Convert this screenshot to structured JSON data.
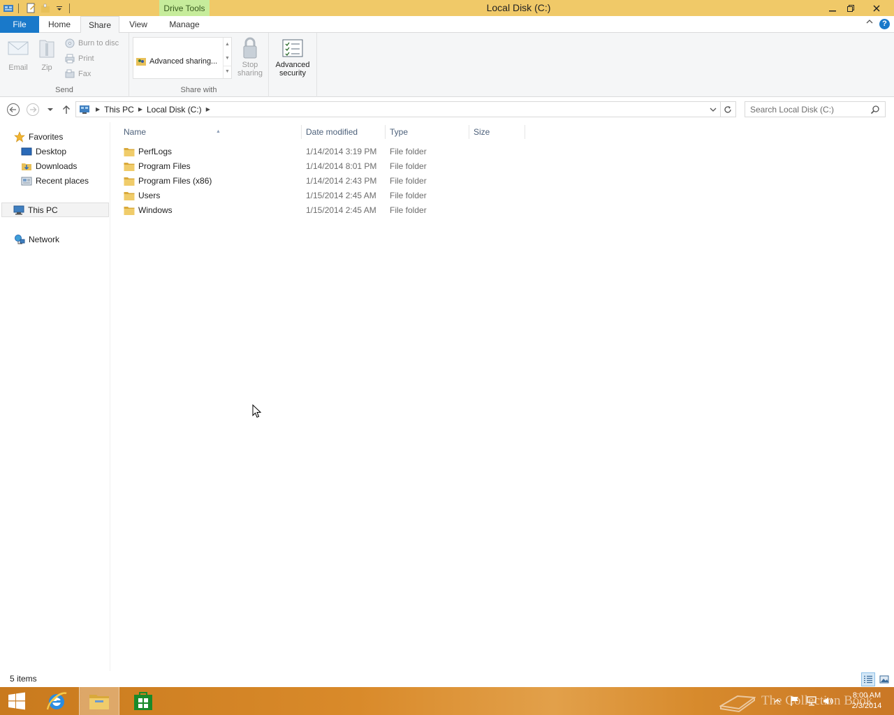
{
  "window": {
    "title": "Local Disk (C:)",
    "context_tab": "Drive Tools"
  },
  "ribbon": {
    "tabs": [
      {
        "label": "File"
      },
      {
        "label": "Home"
      },
      {
        "label": "Share"
      },
      {
        "label": "View"
      },
      {
        "label": "Manage"
      }
    ],
    "send": {
      "group_label": "Send",
      "email": "Email",
      "zip": "Zip",
      "burn": "Burn to disc",
      "print": "Print",
      "fax": "Fax"
    },
    "share_with": {
      "group_label": "Share with",
      "advanced_sharing": "Advanced sharing...",
      "stop_sharing_line1": "Stop",
      "stop_sharing_line2": "sharing"
    },
    "advanced_security_line1": "Advanced",
    "advanced_security_line2": "security"
  },
  "address": {
    "crumbs": [
      "This PC",
      "Local Disk (C:)"
    ],
    "search_placeholder": "Search Local Disk (C:)"
  },
  "nav": {
    "favorites": "Favorites",
    "desktop": "Desktop",
    "downloads": "Downloads",
    "recent": "Recent places",
    "this_pc": "This PC",
    "network": "Network"
  },
  "columns": {
    "name": "Name",
    "date": "Date modified",
    "type": "Type",
    "size": "Size"
  },
  "files": [
    {
      "name": "PerfLogs",
      "date": "1/14/2014 3:19 PM",
      "type": "File folder"
    },
    {
      "name": "Program Files",
      "date": "1/14/2014 8:01 PM",
      "type": "File folder"
    },
    {
      "name": "Program Files (x86)",
      "date": "1/14/2014 2:43 PM",
      "type": "File folder"
    },
    {
      "name": "Users",
      "date": "1/15/2014 2:45 AM",
      "type": "File folder"
    },
    {
      "name": "Windows",
      "date": "1/15/2014 2:45 AM",
      "type": "File folder"
    }
  ],
  "status": {
    "items": "5 items"
  },
  "taskbar": {
    "time": "8:00 AM",
    "date": "2/3/2014",
    "watermark": "The Collection Book"
  },
  "colors": {
    "titlebar": "#f0c968",
    "file_tab": "#1979ca",
    "context_tab": "#c6ec9b",
    "folder": "#e8c058"
  }
}
